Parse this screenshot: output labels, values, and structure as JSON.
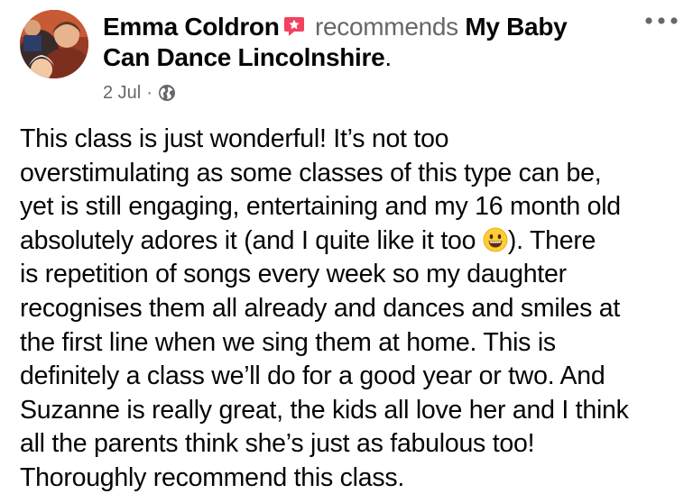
{
  "post": {
    "author": "Emma Coldron",
    "verb": "recommends",
    "page_line1": "My Baby",
    "page_line2": "Can Dance Lincolnshire",
    "period": ".",
    "date": "2 Jul",
    "separator": "·",
    "privacy_icon": "globe-icon",
    "badge_icon": "recommend-badge-icon",
    "more_icon": "more-options-icon",
    "body_lines": [
      "This class is just wonderful! It’s not too",
      "overstimulating as some classes of this type can be,",
      "yet is still engaging, entertaining and my 16 month old",
      "absolutely adores it (and I quite like it too ",
      "). There",
      "is repetition of songs every week so my daughter",
      "recognises them all already and dances and smiles at",
      "the first line when we sing them at home. This is",
      "definitely a class we’ll do for a good year or two. And",
      "Suzanne is really great, the kids all love her and I think",
      "all the parents think she’s just as fabulous too!",
      "Thoroughly recommend this class."
    ],
    "emoji_icon": "grinning-face-emoji"
  },
  "colors": {
    "text": "#050505",
    "secondary": "#65676b",
    "badge": "#f3425f",
    "emoji_face": "#ffcc33"
  }
}
